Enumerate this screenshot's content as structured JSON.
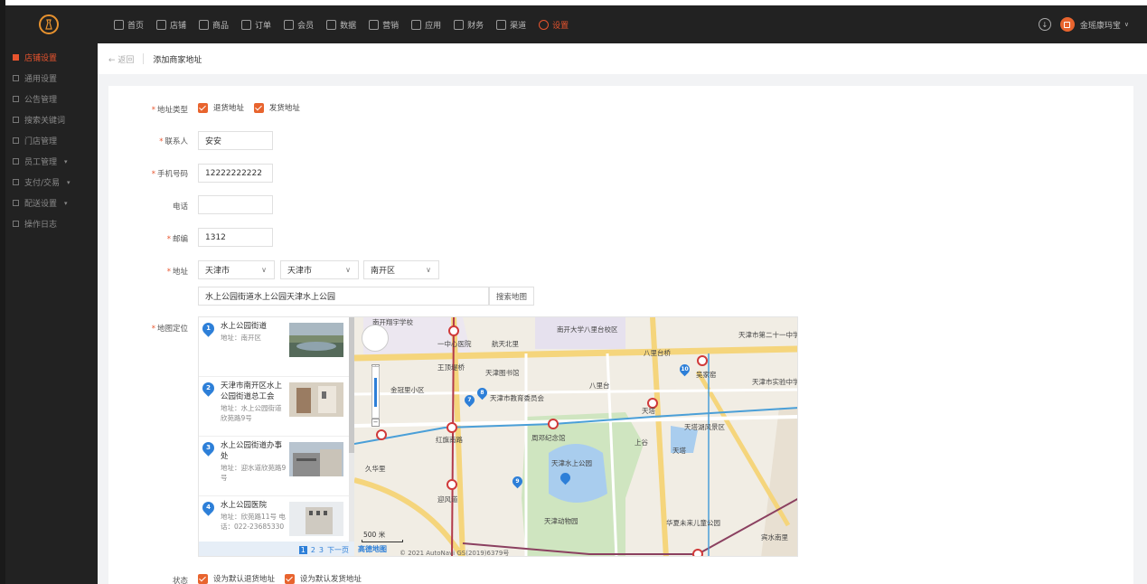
{
  "topnav": {
    "items": [
      {
        "label": "首页"
      },
      {
        "label": "店铺"
      },
      {
        "label": "商品"
      },
      {
        "label": "订单"
      },
      {
        "label": "会员"
      },
      {
        "label": "数据"
      },
      {
        "label": "营销"
      },
      {
        "label": "应用"
      },
      {
        "label": "财务"
      },
      {
        "label": "渠道"
      },
      {
        "label": "设置",
        "active": true
      }
    ],
    "user_name": "金瑶康玛宝"
  },
  "sidebar": {
    "items": [
      {
        "label": "店铺设置"
      },
      {
        "label": "通用设置"
      },
      {
        "label": "公告管理"
      },
      {
        "label": "搜索关键词"
      },
      {
        "label": "门店管理"
      },
      {
        "label": "员工管理"
      },
      {
        "label": "支付/交易"
      },
      {
        "label": "配送设置"
      },
      {
        "label": "操作日志"
      }
    ]
  },
  "breadcrumb": {
    "back": "返回",
    "title": "添加商家地址"
  },
  "form": {
    "address_type": {
      "label": "地址类型",
      "options": [
        "退货地址",
        "发货地址"
      ]
    },
    "contact": {
      "label": "联系人",
      "value": "安安"
    },
    "mobile": {
      "label": "手机号码",
      "value": "12222222222"
    },
    "phone": {
      "label": "电话",
      "value": ""
    },
    "postcode": {
      "label": "邮编",
      "value": "1312"
    },
    "address": {
      "label": "地址",
      "province": "天津市",
      "city": "天津市",
      "district": "南开区",
      "detail": "水上公园街道水上公园天津水上公园",
      "search_button": "搜索地图"
    },
    "map_label": "地图定位",
    "status": {
      "label": "状态",
      "options": [
        "设为默认退货地址",
        "设为默认发货地址"
      ]
    }
  },
  "map": {
    "results": [
      {
        "num": "1",
        "name": "水上公园街道",
        "info": "地址：南开区"
      },
      {
        "num": "2",
        "name": "天津市南开区水上公园街道总工会",
        "info": "地址：水上公园街道欣苑路9号"
      },
      {
        "num": "3",
        "name": "水上公园街道办事处",
        "info": "地址：迎水道欣苑路9号"
      },
      {
        "num": "4",
        "name": "水上公园医院",
        "info": "地址：欣苑路11号 电话：022-23685330"
      }
    ],
    "pager": {
      "p1": "1",
      "p2": "2",
      "p3": "3",
      "next": "下一页"
    },
    "places": [
      "南开翔宇学校",
      "一中心医院",
      "南开大学八里台校区",
      "航天北里",
      "天津市第二十一中学",
      "八里台桥",
      "王顶堤桥",
      "天津图书馆",
      "吴家窑",
      "金冠里小区",
      "天津市教育委员会",
      "八里台",
      "天津市实验中学",
      "天塔",
      "天塔湖风景区",
      "红旗南路",
      "周邓纪念馆",
      "上谷",
      "天塔",
      "天津水上公园",
      "久华里",
      "迎风道",
      "天津动物园",
      "华夏未来儿童公园",
      "宾水南里"
    ],
    "scale": "500 米",
    "brand": "高德地图",
    "credit": "© 2021 AutoNavi GS(2019)6379号"
  },
  "colors": {
    "accent": "#e8542e",
    "map_blue": "#2d7fd8"
  }
}
